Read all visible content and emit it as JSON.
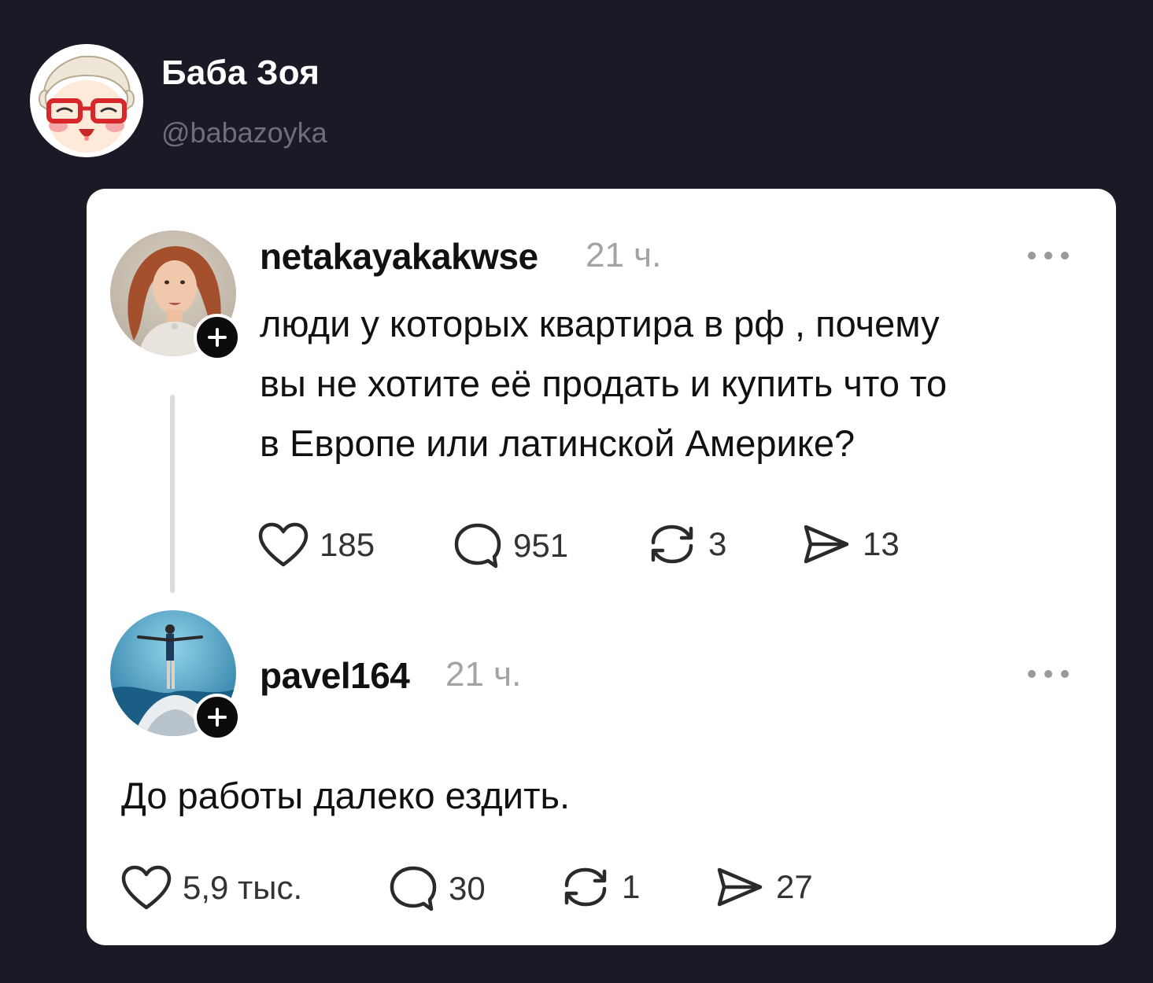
{
  "channel": {
    "name": "Баба Зоя",
    "handle": "@babazoyka",
    "avatar_icon": "cartoon-grandma-icon"
  },
  "posts": [
    {
      "username": "netakayakakwse",
      "time": "21 ч.",
      "text": "люди у которых квартира в рф , почему\nвы не хотите её продать и купить что то\nв Европе или латинской Америке?",
      "likes": "185",
      "comments": "951",
      "reposts": "3",
      "shares": "13",
      "avatar_icon": "woman-portrait-avatar"
    },
    {
      "username": "pavel164",
      "time": "21 ч.",
      "text": "До работы далеко ездить.",
      "likes": "5,9 тыс.",
      "comments": "30",
      "reposts": "1",
      "shares": "27",
      "avatar_icon": "man-on-rock-avatar"
    }
  ],
  "colors": {
    "background": "#1a1a26",
    "card": "#ffffff",
    "text": "#111111",
    "muted": "#a3a3a3"
  }
}
